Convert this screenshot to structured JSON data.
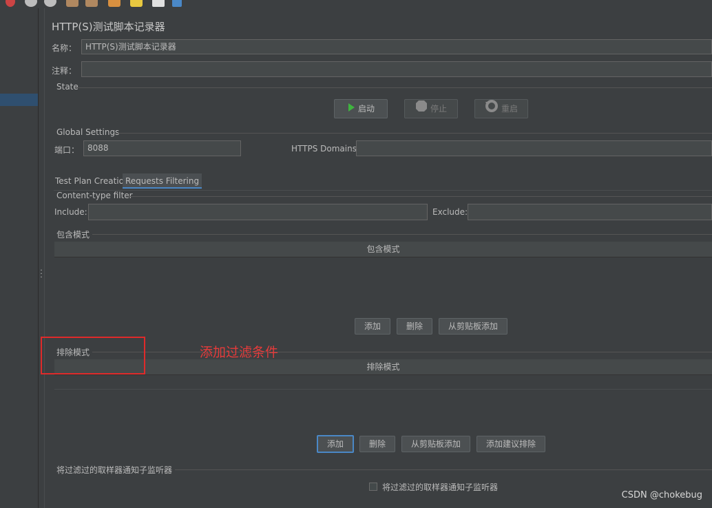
{
  "panel": {
    "title": "HTTP(S)测试脚本记录器",
    "name_label": "名称：",
    "name_value": "HTTP(S)测试脚本记录器",
    "comment_label": "注释："
  },
  "state": {
    "section_label": "State",
    "start_label": "启动",
    "stop_label": "停止",
    "restart_label": "重启"
  },
  "global_settings": {
    "section_label": "Global Settings",
    "port_label": "端口：",
    "port_value": "8088",
    "https_domains_label": "HTTPS Domains:",
    "https_domains_value": ""
  },
  "tabs": [
    {
      "label": "Test Plan Creation",
      "selected": false
    },
    {
      "label": "Requests Filtering",
      "selected": true
    }
  ],
  "content_type_filter": {
    "section_label": "Content-type filter",
    "include_label": "Include:",
    "include_value": "",
    "exclude_label": "Exclude:",
    "exclude_value": ""
  },
  "include_patterns": {
    "section_label": "包含模式",
    "column_header": "包含模式",
    "add_label": "添加",
    "delete_label": "删除",
    "paste_label": "从剪贴板添加"
  },
  "exclude_patterns": {
    "section_label": "排除模式",
    "column_header": "排除模式",
    "add_label": "添加",
    "delete_label": "删除",
    "paste_label": "从剪贴板添加",
    "suggest_label": "添加建议排除"
  },
  "notify": {
    "section_label": "将过滤过的取样器通知子监听器",
    "checkbox_label": "将过滤过的取样器通知子监听器",
    "checked": false
  },
  "annotation": {
    "text": "添加过滤条件",
    "color": "#e63b3b"
  },
  "watermark": "CSDN @chokebug",
  "colors": {
    "background": "#3c3f41",
    "accent": "#4a88c7",
    "start_icon": "#3fb43f"
  }
}
